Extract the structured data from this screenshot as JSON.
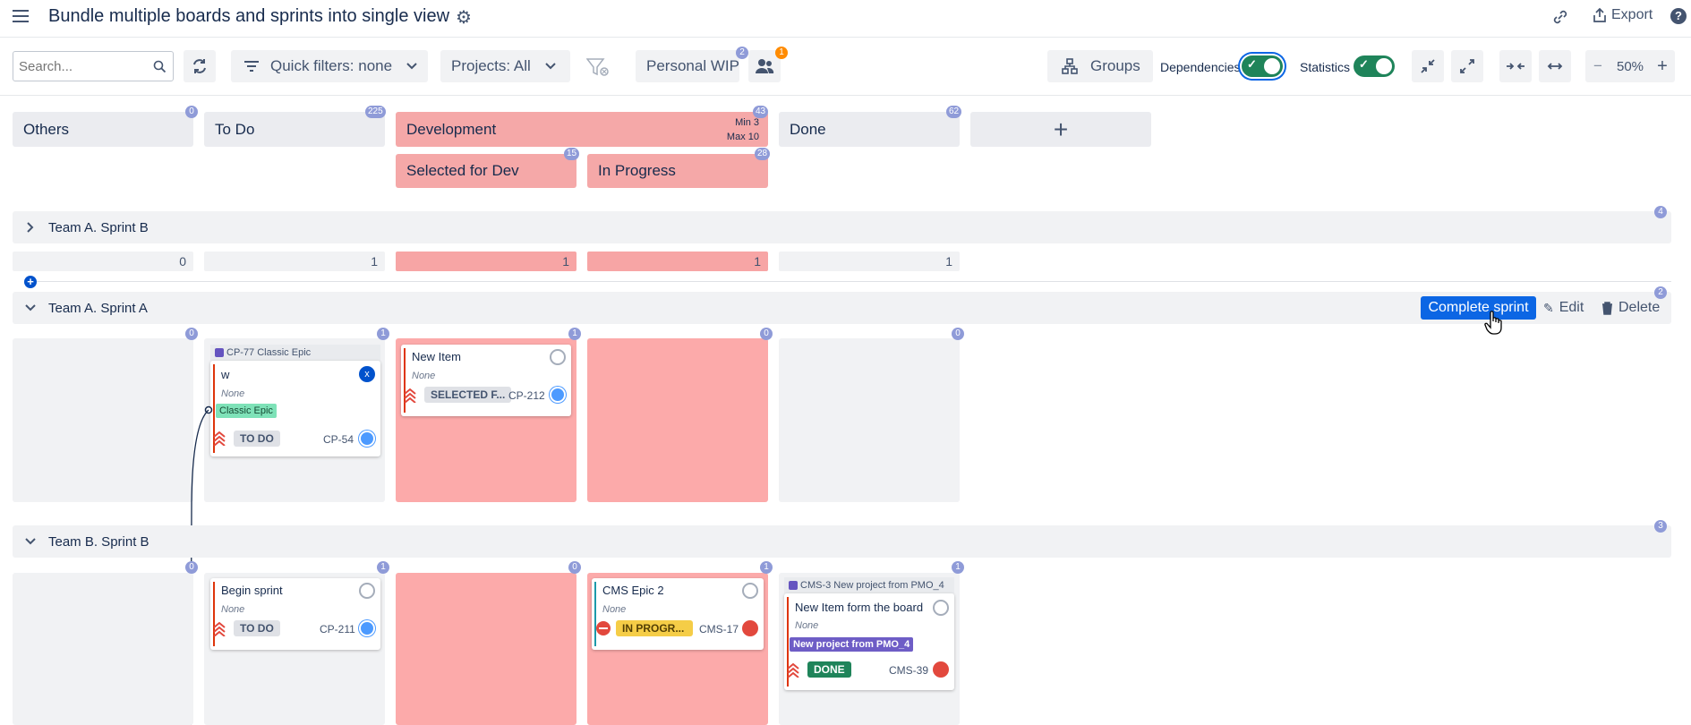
{
  "header": {
    "title": "Bundle multiple boards and sprints into single view",
    "export_label": "Export"
  },
  "toolbar": {
    "search_placeholder": "Search...",
    "quick_filters_label": "Quick filters: none",
    "projects_label": "Projects: All",
    "personal_wip_label": "Personal WIP",
    "personal_wip_badge": "2",
    "people_badge": "1",
    "groups_label": "Groups",
    "dependencies_label": "Dependencies",
    "statistics_label": "Statistics",
    "zoom_minus": "−",
    "zoom_value": "50%",
    "zoom_plus": "+"
  },
  "columns": {
    "others": {
      "label": "Others",
      "count": "0"
    },
    "todo": {
      "label": "To Do",
      "count": "225"
    },
    "development": {
      "label": "Development",
      "count": "43",
      "min": "Min 3",
      "max": "Max 10"
    },
    "done": {
      "label": "Done",
      "count": "62"
    },
    "add": "+",
    "selected_for_dev": {
      "label": "Selected for Dev",
      "count": "15"
    },
    "in_progress": {
      "label": "In Progress",
      "count": "28"
    }
  },
  "swimlanes": {
    "team_a_sprint_b": {
      "label": "Team A. Sprint B",
      "count": "4",
      "col_counts": [
        "0",
        "1",
        "1",
        "1",
        "1"
      ]
    },
    "team_a_sprint_a": {
      "label": "Team A. Sprint A",
      "count": "2",
      "col_counts": [
        "0",
        "1",
        "1",
        "0",
        "0"
      ],
      "complete_label": "Complete sprint",
      "edit_label": "Edit",
      "delete_label": "Delete"
    },
    "team_b_sprint_b": {
      "label": "Team B. Sprint B",
      "count": "3",
      "col_counts": [
        "0",
        "1",
        "0",
        "1",
        "1"
      ]
    }
  },
  "cards": {
    "cp54": {
      "epic": "CP-77 Classic Epic",
      "title": "w",
      "none": "None",
      "epic_label": "Classic Epic",
      "status": "TO DO",
      "key": "CP-54",
      "assignee_initial": "x"
    },
    "cp212": {
      "title": "New Item",
      "none": "None",
      "status": "SELECTED F...",
      "key": "CP-212"
    },
    "cp211": {
      "title": "Begin sprint",
      "none": "None",
      "status": "TO DO",
      "key": "CP-211"
    },
    "cms17": {
      "title": "CMS Epic 2",
      "none": "None",
      "status": "IN PROGR...",
      "key": "CMS-17"
    },
    "cms39": {
      "epic": "CMS-3 New project from PMO_4",
      "title": "New Item form the board",
      "none": "None",
      "epic_label": "New project from PMO_4",
      "status": "DONE",
      "key": "CMS-39"
    }
  },
  "colors": {
    "accent": "#0052cc",
    "dev_column": "#f5a8a8",
    "wip_cell": "#fcaaaa",
    "toggle_on": "#1f845a",
    "done_lozenge": "#1f845a",
    "inprogress_lozenge": "#f5cd47",
    "epic_purple": "#6554c0"
  }
}
